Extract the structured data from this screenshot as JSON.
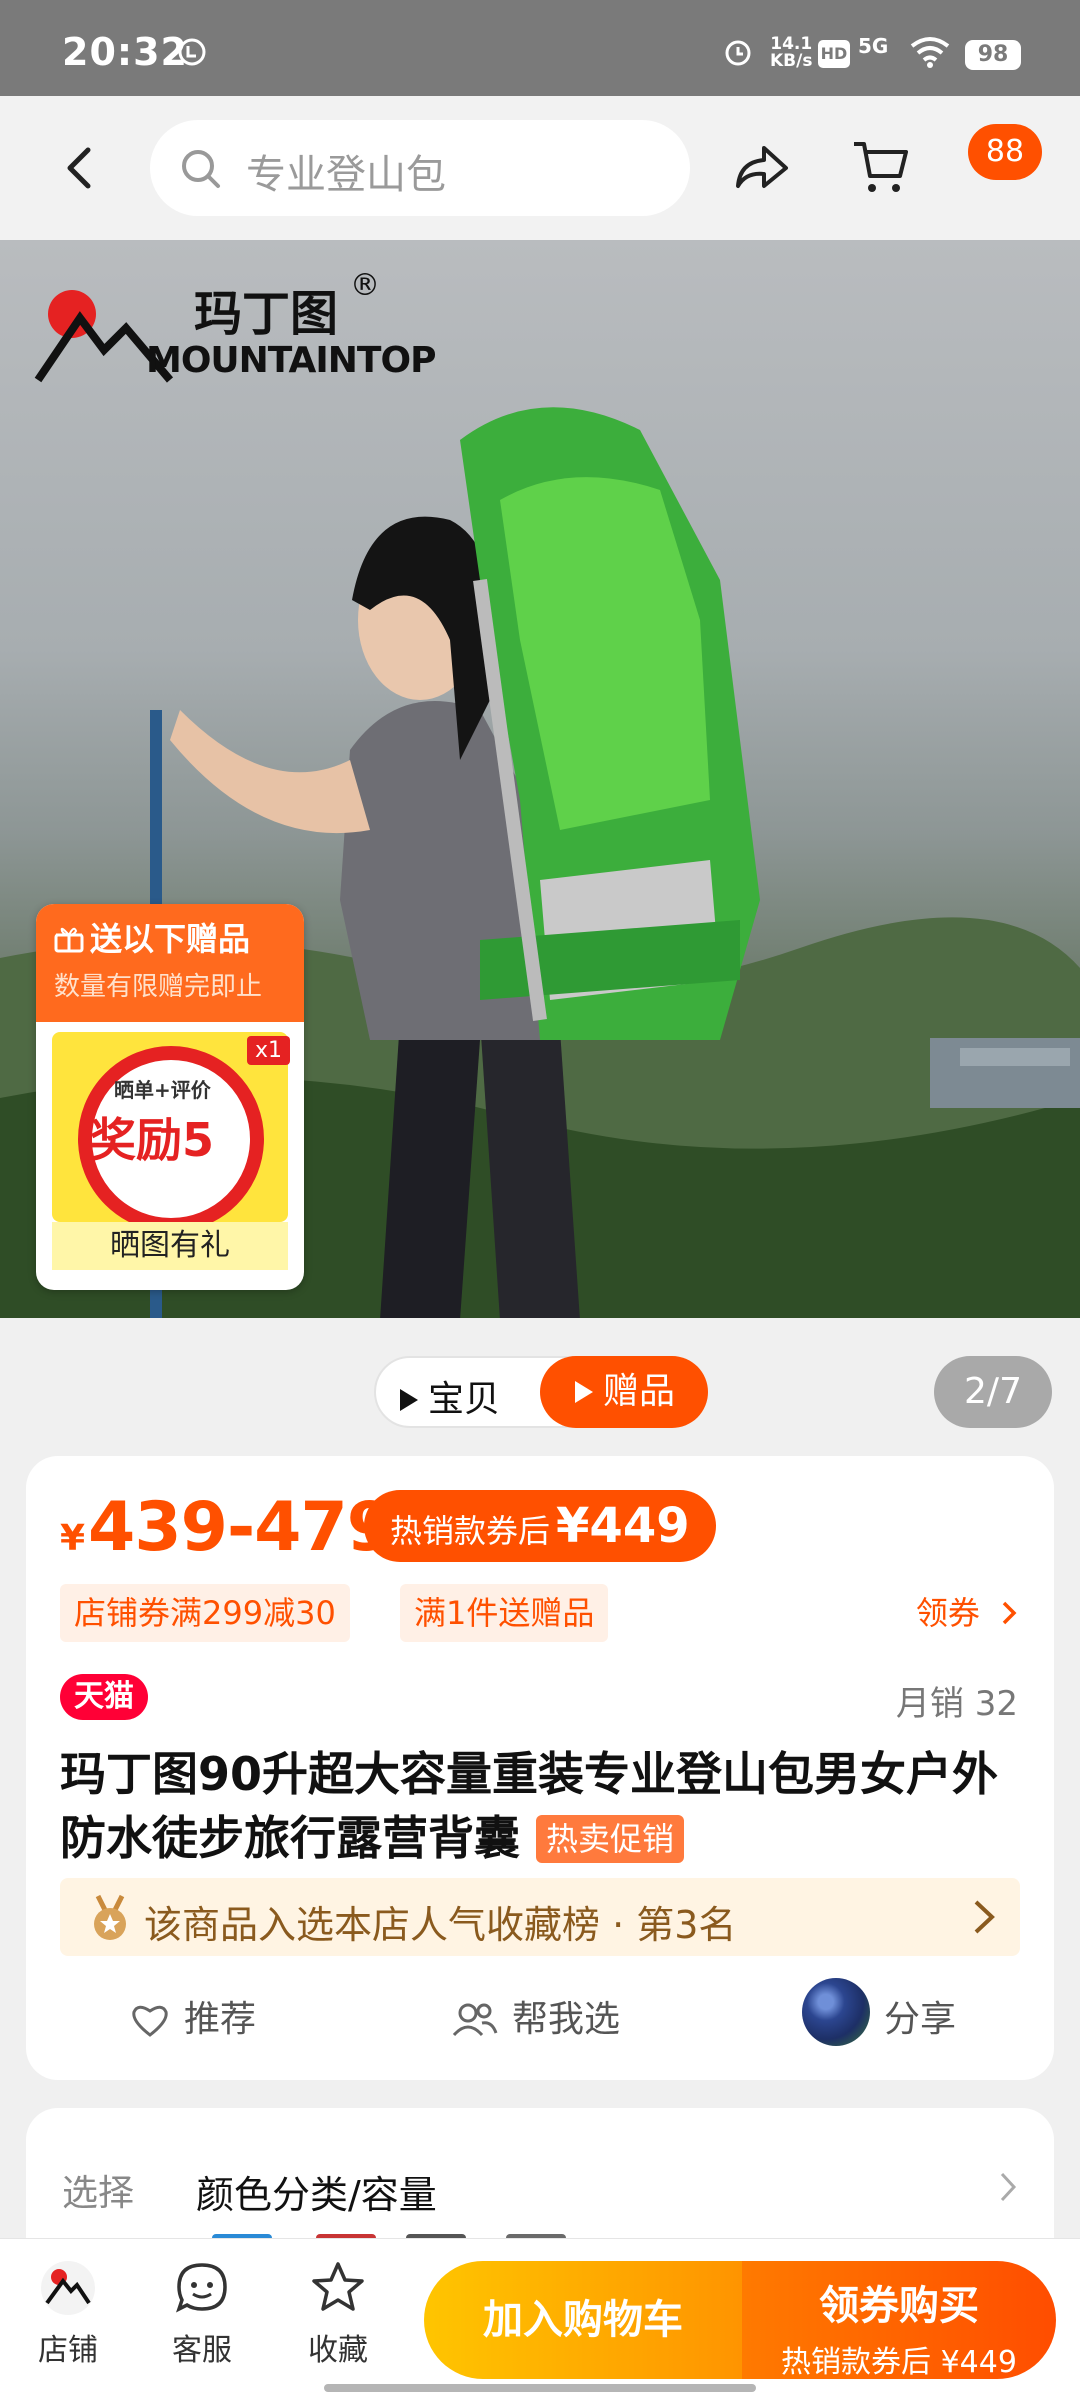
{
  "status_bar": {
    "time": "20:32",
    "network_speed_value": "14.1",
    "network_speed_unit": "KB/s",
    "hd_label": "HD",
    "signal_label": "5G",
    "battery": "98"
  },
  "search": {
    "placeholder": "专业登山包",
    "cart_badge": "88"
  },
  "hero": {
    "brand_cn": "玛丁图",
    "brand_en": "MOUNTAINTOP",
    "brand_reg": "®",
    "gift_title": "送以下赠品",
    "gift_subtitle": "数量有限赠完即止",
    "gift_quantity": "x1",
    "gift_image_small": "晒单+评价",
    "gift_image_text": "奖励5",
    "gift_caption": "晒图有礼"
  },
  "media": {
    "video_label": "宝贝",
    "gift_label": "赠品",
    "page_counter": "2/7"
  },
  "price": {
    "currency": "¥",
    "range": "439-479",
    "coupon_label": "热销款券后",
    "coupon_value": "¥449",
    "tags": [
      "店铺券满299减30",
      "满1件送赠品"
    ],
    "claim_label": "领券",
    "store_badge": "天猫",
    "monthly_sales": "月销 32",
    "title": "玛丁图90升超大容量重装专业登山包男女户外防水徒步旅行露营背囊",
    "hot_tag": "热卖促销",
    "rank_text": "该商品入选本店人气收藏榜 · 第3名",
    "actions": {
      "recommend": "推荐",
      "help_choose": "帮我选",
      "share": "分享"
    }
  },
  "options": {
    "label": "选择",
    "value": "颜色分类/容量"
  },
  "bottom_bar": {
    "store": "店铺",
    "service": "客服",
    "favorite": "收藏",
    "add_to_cart": "加入购物车",
    "buy_main": "领券购买",
    "buy_sub": "热销款券后 ¥449"
  },
  "colors": {
    "accent": "#ff5000",
    "tmall": "#ff0036",
    "cart_button": "#ffb000"
  }
}
